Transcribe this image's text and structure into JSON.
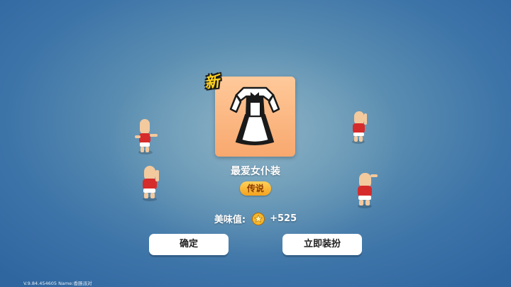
{
  "reward": {
    "new_badge": "新",
    "item_name": "最爱女仆装",
    "rarity": "传说",
    "tasty_label": "美味值:",
    "tasty_value": "+525",
    "item_icon": "maid-dress-icon",
    "star_icon": "star-coin-icon"
  },
  "buttons": {
    "confirm": "确定",
    "equip_now": "立即装扮"
  },
  "footer": {
    "version": "V.9.84.454605 Name:香肠派对"
  },
  "colors": {
    "card_bg": "#f8a86e",
    "rarity_gold": "#f5a21d",
    "new_badge_yellow": "#ffd21f",
    "bg_blue": "#3d74a8"
  }
}
